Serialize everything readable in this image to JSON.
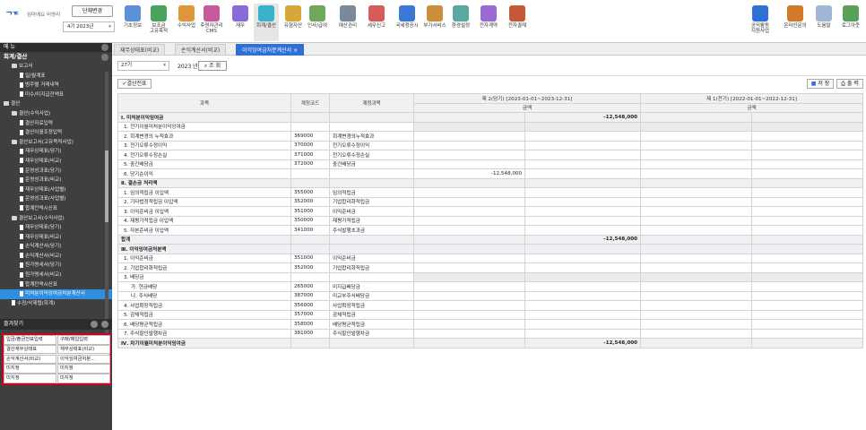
{
  "header": {
    "logo": "ᄀᄀᄃ",
    "logo_sub": "임마에요 비영리",
    "company_button": "단체변경",
    "year_select": "4기 2023년",
    "menus": [
      "기초정보",
      "보조금\n고유목적",
      "수익사업",
      "후원자관리\nCMS",
      "재무",
      "회계/결산",
      "유형자산",
      "인사/급여",
      "예산관리",
      "세무신고",
      "국세청공시",
      "부가서비스",
      "환경설정",
      "전자계약",
      "전자결재"
    ],
    "right_menus": [
      "공익활동\n지원사업",
      "온라인문의",
      "도움말",
      "로그아웃"
    ]
  },
  "leftpanel": {
    "menu_label": "메 뉴",
    "tree_title": "회계/결산",
    "tree": [
      {
        "label": "보고서",
        "level": 1,
        "type": "folder"
      },
      {
        "label": "일/월계표",
        "level": 2,
        "type": "doc"
      },
      {
        "label": "범주별 거래내역",
        "level": 2,
        "type": "doc"
      },
      {
        "label": "미수/미지급잔액표",
        "level": 2,
        "type": "doc"
      },
      {
        "label": "결산",
        "level": 0,
        "type": "folder"
      },
      {
        "label": "결산(수익사업)",
        "level": 1,
        "type": "folder"
      },
      {
        "label": "결산자료입력",
        "level": 2,
        "type": "doc"
      },
      {
        "label": "결산이월조정입력",
        "level": 2,
        "type": "doc"
      },
      {
        "label": "결산보고서(고유목적사업)",
        "level": 1,
        "type": "folder"
      },
      {
        "label": "재무상태표(당기)",
        "level": 2,
        "type": "doc"
      },
      {
        "label": "재무상태표(비교)",
        "level": 2,
        "type": "doc"
      },
      {
        "label": "운영성과표(당기)",
        "level": 2,
        "type": "doc"
      },
      {
        "label": "운영성과표(비교)",
        "level": 2,
        "type": "doc"
      },
      {
        "label": "재무상태표(사업별)",
        "level": 2,
        "type": "doc"
      },
      {
        "label": "운영성과표(사업별)",
        "level": 2,
        "type": "doc"
      },
      {
        "label": "합계잔액시산표",
        "level": 2,
        "type": "doc"
      },
      {
        "label": "결산보고서(수익사업)",
        "level": 1,
        "type": "folder"
      },
      {
        "label": "재무상태표(당기)",
        "level": 2,
        "type": "doc"
      },
      {
        "label": "재무상태표(비교)",
        "level": 2,
        "type": "doc"
      },
      {
        "label": "손익계산서(당기)",
        "level": 2,
        "type": "doc"
      },
      {
        "label": "손익계산서(비교)",
        "level": 2,
        "type": "doc"
      },
      {
        "label": "원가명세서(당기)",
        "level": 2,
        "type": "doc"
      },
      {
        "label": "원가명세서(비교)",
        "level": 2,
        "type": "doc"
      },
      {
        "label": "합계잔액시산표",
        "level": 2,
        "type": "doc"
      },
      {
        "label": "미처분이익잉여금처분계산서",
        "level": 2,
        "type": "doc",
        "selected": true
      },
      {
        "label": "수정/삭제탭(회계)",
        "level": 1,
        "type": "doc"
      }
    ],
    "favorites_label": "즐겨찾기",
    "favorites": [
      "입금/출금전표입력",
      "구매/매입입력",
      "결산재무상태표",
      "재무상태표(비교)",
      "손익계산서(비교)",
      "이익잉여금처분...",
      "미지정",
      "미지정",
      "미지정",
      "미지정"
    ]
  },
  "tabs": [
    "재무상태표(비교)",
    "손익계산서(비교)",
    "이익잉여금처분계산서"
  ],
  "search": {
    "period": "27기",
    "year_label": "2023 년",
    "search_button": "조 회"
  },
  "toolbar": {
    "close_button": "결산전표",
    "save_button": "저 장",
    "print_button": "출 력"
  },
  "table": {
    "headers": {
      "subject": "과목",
      "code": "계정코드",
      "account": "계정과목",
      "current_period": "제 2(당기) [2023-01-01~2023-12-31]",
      "prior_period": "제 1(전기) [2022-01-01~2022-12-31]",
      "amount": "금액"
    },
    "rows": [
      {
        "type": "sec",
        "subject": "Ⅰ. 미처분이익잉여금",
        "code": "",
        "account": "",
        "c2": "-12,548,000",
        "p2": ""
      },
      {
        "type": "row",
        "subject": "1. 전기이월미처분이익잉여금",
        "code": "",
        "account": "",
        "c1": "",
        "c2": "",
        "gray": true
      },
      {
        "type": "row",
        "subject": "2. 회계변경의 누적효과",
        "code": "369000",
        "account": "회계변경의누적효과",
        "c1": "",
        "c2": ""
      },
      {
        "type": "row",
        "subject": "3. 전기오류수정이익",
        "code": "370000",
        "account": "전기오류수정이익",
        "c1": "",
        "c2": ""
      },
      {
        "type": "row",
        "subject": "4. 전기오류수정손실",
        "code": "371000",
        "account": "전기오류수정손실",
        "c1": "",
        "c2": ""
      },
      {
        "type": "row",
        "subject": "5. 중간배당금",
        "code": "372000",
        "account": "중간배당금",
        "c1": "",
        "c2": ""
      },
      {
        "type": "row",
        "subject": "6. 당기순이익",
        "code": "",
        "account": "",
        "c1": "-12,548,000",
        "c2": ""
      },
      {
        "type": "sec",
        "subject": "Ⅱ. 결손금 처리액",
        "code": "",
        "account": "",
        "c2": "",
        "p2": ""
      },
      {
        "type": "row",
        "subject": "1. 임의적립금 이입액",
        "code": "355000",
        "account": "임의적립금",
        "c1": "",
        "c2": ""
      },
      {
        "type": "row",
        "subject": "2. 기타법정적립금 이입액",
        "code": "352000",
        "account": "기업합리화적립금",
        "c1": "",
        "c2": ""
      },
      {
        "type": "row",
        "subject": "3. 이익준비금 이입액",
        "code": "351000",
        "account": "이익준비금",
        "c1": "",
        "c2": ""
      },
      {
        "type": "row",
        "subject": "4. 재평가적립금 이입액",
        "code": "350000",
        "account": "재평가적립금",
        "c1": "",
        "c2": ""
      },
      {
        "type": "row",
        "subject": "5. 자본준비금 이입액",
        "code": "341000",
        "account": "주식발행초과금",
        "c1": "",
        "c2": ""
      },
      {
        "type": "sec",
        "subject": "합계",
        "code": "",
        "account": "",
        "c2": "-12,548,000",
        "p2": ""
      },
      {
        "type": "sec",
        "subject": "Ⅲ. 이익잉여금처분액",
        "code": "",
        "account": "",
        "c2": "",
        "p2": ""
      },
      {
        "type": "row",
        "subject": "1. 이익준비금",
        "code": "351000",
        "account": "이익준비금",
        "c1": "",
        "c2": ""
      },
      {
        "type": "row",
        "subject": "2. 기업합리화적립금",
        "code": "352000",
        "account": "기업합리화적립금",
        "c1": "",
        "c2": ""
      },
      {
        "type": "row",
        "subject": "3. 배당금",
        "code": "",
        "account": "",
        "c1": "",
        "c2": "",
        "gray": true
      },
      {
        "type": "sub",
        "subject": "가. 현금배당",
        "code": "265000",
        "account": "미지급배당금",
        "c1": "",
        "c2": ""
      },
      {
        "type": "sub",
        "subject": "나. 주식배당",
        "code": "387000",
        "account": "미교부주식배당금",
        "c1": "",
        "c2": ""
      },
      {
        "type": "row",
        "subject": "4. 사업확장적립금",
        "code": "356000",
        "account": "사업확장적립금",
        "c1": "",
        "c2": ""
      },
      {
        "type": "row",
        "subject": "5. 감채적립금",
        "code": "357000",
        "account": "감채적립금",
        "c1": "",
        "c2": ""
      },
      {
        "type": "row",
        "subject": "6. 배당평균적립금",
        "code": "358000",
        "account": "배당평균적립금",
        "c1": "",
        "c2": ""
      },
      {
        "type": "row",
        "subject": "7. 주식할인발행차금",
        "code": "381000",
        "account": "주식할인발행차금",
        "c1": "",
        "c2": ""
      },
      {
        "type": "sec",
        "subject": "Ⅳ. 차기이월미처분이익잉여금",
        "code": "",
        "account": "",
        "c2": "-12,548,000",
        "p2": ""
      }
    ]
  },
  "colors": {
    "accent": "#2f6fd6",
    "panel": "#3f3f3f",
    "highlight": "#d0021b"
  }
}
